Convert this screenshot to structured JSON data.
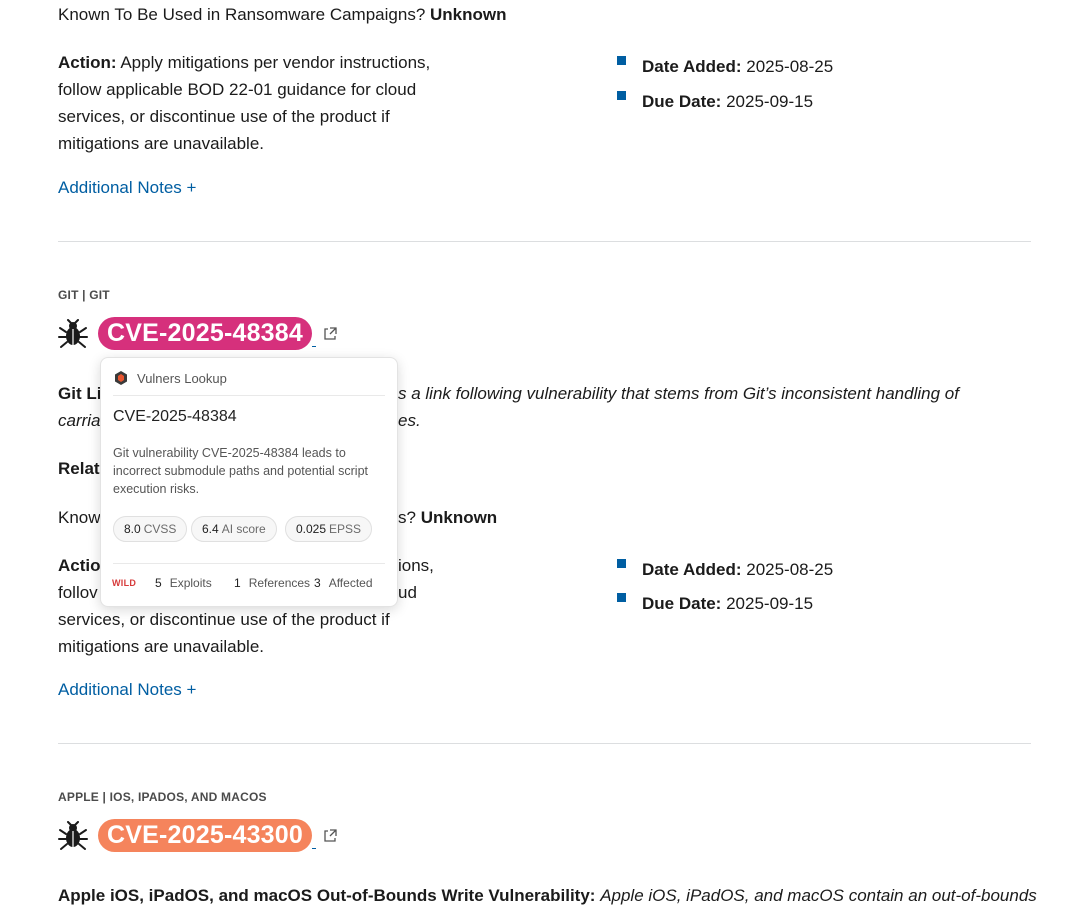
{
  "entry1": {
    "ransomware_label": "Known To Be Used in Ransomware Campaigns?",
    "ransomware_value": "Unknown",
    "action_label": "Action:",
    "action_lines": [
      "Apply mitigations per vendor instructions,",
      "follow applicable BOD 22-01 guidance for cloud",
      "services, or discontinue use of the product if",
      "mitigations are unavailable."
    ],
    "date_added_label": "Date Added:",
    "date_added": "2025-08-25",
    "due_date_label": "Due Date:",
    "due_date": "2025-09-15",
    "notes_link": "Additional Notes +"
  },
  "entry2": {
    "vendor": "GIT | GIT",
    "cve_id": "CVE-2025-48384",
    "cve_color": "#d6307c",
    "title_visible": "Git Li",
    "desc_line1_visible": "s a link following vulnerability that stems from Git’s inconsistent handling of",
    "desc_line2_left": "carria",
    "desc_line2_right": "es.",
    "related_label_visible": "Relat",
    "ransomware_label_left": "Know",
    "ransomware_label_right": "s?",
    "ransomware_value": "Unknown",
    "action_label_visible": "Actio",
    "action_line1_right": "ions,",
    "action_line2_left": "follov",
    "action_line2_right": "ud",
    "action_lines_rest": [
      "services, or discontinue use of the product if",
      "mitigations are unavailable."
    ],
    "date_added_label": "Date Added:",
    "date_added": "2025-08-25",
    "due_date_label": "Due Date:",
    "due_date": "2025-09-15",
    "notes_link": "Additional Notes +"
  },
  "entry3": {
    "vendor": "APPLE | IOS, IPADOS, AND MACOS",
    "cve_id": "CVE-2025-43300",
    "cve_color": "#f5845c",
    "title": "Apple iOS, iPadOS, and macOS Out-of-Bounds Write Vulnerability:",
    "desc_visible": "Apple iOS, iPadOS, and macOS contain an out-of-bounds"
  },
  "popup": {
    "header": "Vulners Lookup",
    "cve_id": "CVE-2025-48384",
    "description": "Git vulnerability CVE-2025-48384 leads to incorrect submodule paths and potential script execution risks.",
    "chips": [
      {
        "value": "8.0",
        "label": "CVSS"
      },
      {
        "value": "6.4",
        "label": "AI score"
      },
      {
        "value": "0.025",
        "label": "EPSS"
      }
    ],
    "wild": "WILD",
    "exploits_count": "5",
    "exploits_label": "Exploits",
    "references_count": "1",
    "references_label": "References",
    "affected_count": "3",
    "affected_label": "Affected",
    "accent_color": "#d63a3a"
  }
}
